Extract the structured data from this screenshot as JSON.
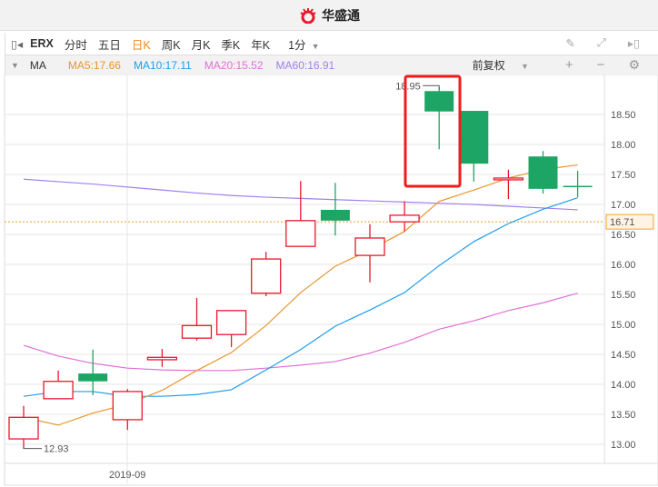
{
  "header": {
    "title": "华盛通"
  },
  "toolbar": {
    "symbol": "ERX",
    "tabs": [
      "分时",
      "五日",
      "日K",
      "周K",
      "月K",
      "季K",
      "年K"
    ],
    "active_tab": "日K",
    "interval": "1分"
  },
  "ma_bar": {
    "label": "MA",
    "ma5": "MA5:17.66",
    "ma10": "MA10:17.11",
    "ma20": "MA20:15.52",
    "ma60": "MA60:16.91",
    "adjust": "前复权"
  },
  "colors": {
    "up": "#e8192c",
    "down": "#1ca564",
    "ma5": "#e8962e",
    "ma10": "#1e9ee8",
    "ma20": "#e070d8",
    "ma60": "#a080f0",
    "active": "#f08a1c"
  },
  "chart_data": {
    "type": "candlestick",
    "y_ticks": [
      "18.50",
      "18.00",
      "17.50",
      "17.00",
      "16.50",
      "16.00",
      "15.50",
      "15.00",
      "14.50",
      "14.00",
      "13.50",
      "13.00"
    ],
    "x_label": "2019-09",
    "current_price": "16.71",
    "max_label": "18.95",
    "min_label": "12.93",
    "candles": [
      {
        "o": 13.09,
        "c": 13.45,
        "h": 13.64,
        "l": 12.93
      },
      {
        "o": 13.76,
        "c": 14.05,
        "h": 14.23,
        "l": 13.76
      },
      {
        "o": 14.18,
        "c": 14.05,
        "h": 14.58,
        "l": 13.82
      },
      {
        "o": 13.41,
        "c": 13.88,
        "h": 13.92,
        "l": 13.24
      },
      {
        "o": 14.41,
        "c": 14.45,
        "h": 14.59,
        "l": 14.29
      },
      {
        "o": 14.77,
        "c": 14.98,
        "h": 15.44,
        "l": 14.73
      },
      {
        "o": 14.83,
        "c": 15.23,
        "h": 15.23,
        "l": 14.62
      },
      {
        "o": 15.52,
        "c": 16.09,
        "h": 16.21,
        "l": 15.47
      },
      {
        "o": 16.3,
        "c": 16.73,
        "h": 17.39,
        "l": 16.3
      },
      {
        "o": 16.91,
        "c": 16.73,
        "h": 17.36,
        "l": 16.48
      },
      {
        "o": 16.15,
        "c": 16.44,
        "h": 16.67,
        "l": 15.7
      },
      {
        "o": 16.71,
        "c": 16.82,
        "h": 17.05,
        "l": 16.55
      },
      {
        "o": 18.89,
        "c": 18.55,
        "h": 18.95,
        "l": 17.92
      },
      {
        "o": 18.56,
        "c": 17.68,
        "h": 18.56,
        "l": 17.38
      },
      {
        "o": 17.41,
        "c": 17.44,
        "h": 17.58,
        "l": 17.09
      },
      {
        "o": 17.8,
        "c": 17.26,
        "h": 17.89,
        "l": 17.18
      },
      {
        "o": 17.31,
        "c": 17.3,
        "h": 17.56,
        "l": 17.12
      }
    ],
    "ma5": [
      13.45,
      13.32,
      13.52,
      13.67,
      13.9,
      14.23,
      14.53,
      14.98,
      15.53,
      15.97,
      16.24,
      16.55,
      17.05,
      17.24,
      17.44,
      17.58,
      17.66
    ],
    "ma10": [
      13.8,
      13.88,
      13.88,
      13.8,
      13.8,
      13.83,
      13.91,
      14.24,
      14.58,
      14.97,
      15.24,
      15.53,
      15.98,
      16.38,
      16.68,
      16.92,
      17.11
    ],
    "ma20": [
      14.65,
      14.47,
      14.35,
      14.27,
      14.24,
      14.23,
      14.23,
      14.27,
      14.32,
      14.38,
      14.52,
      14.7,
      14.92,
      15.06,
      15.23,
      15.36,
      15.52
    ],
    "ma60": [
      17.42,
      17.38,
      17.34,
      17.29,
      17.24,
      17.19,
      17.15,
      17.12,
      17.1,
      17.08,
      17.06,
      17.04,
      17.02,
      17.0,
      16.97,
      16.94,
      16.91
    ]
  }
}
